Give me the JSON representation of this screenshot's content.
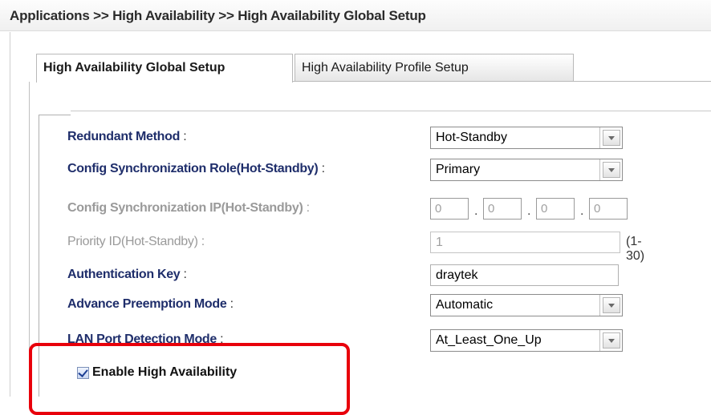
{
  "breadcrumb": "Applications >> High Availability >> High Availability Global Setup",
  "tabs": [
    {
      "label": "High Availability Global Setup",
      "active": true
    },
    {
      "label": "High Availability Profile Setup",
      "active": false
    }
  ],
  "form": {
    "redundant_method": {
      "label": "Redundant Method",
      "colon": " :",
      "value": "Hot-Standby"
    },
    "config_sync_role": {
      "label": "Config Synchronization Role(Hot-Standby)",
      "colon": " :",
      "value": "Primary"
    },
    "config_sync_ip": {
      "label": "Config Synchronization IP(Hot-Standby)",
      "colon": " :",
      "octets": [
        "0",
        "0",
        "0",
        "0"
      ],
      "separator": "."
    },
    "priority_id": {
      "label": "Priority ID(Hot-Standby)",
      "colon": " :",
      "value": "1",
      "range": "(1-30)"
    },
    "auth_key": {
      "label": "Authentication Key",
      "colon": " :",
      "value": "draytek"
    },
    "preemption_mode": {
      "label": "Advance Preemption Mode",
      "colon": " :",
      "value": "Automatic"
    },
    "lan_detection": {
      "label": "LAN Port Detection Mode",
      "colon": " :",
      "value": "At_Least_One_Up"
    },
    "enable_ha": {
      "label": "Enable High Availability",
      "checked": true
    }
  },
  "colors": {
    "label": "#1f2e6b",
    "disabled": "#9a9a9a",
    "highlight": "#e8000b"
  },
  "icons": {
    "dropdown": "chevron-down-icon",
    "checkbox": "check-icon"
  }
}
